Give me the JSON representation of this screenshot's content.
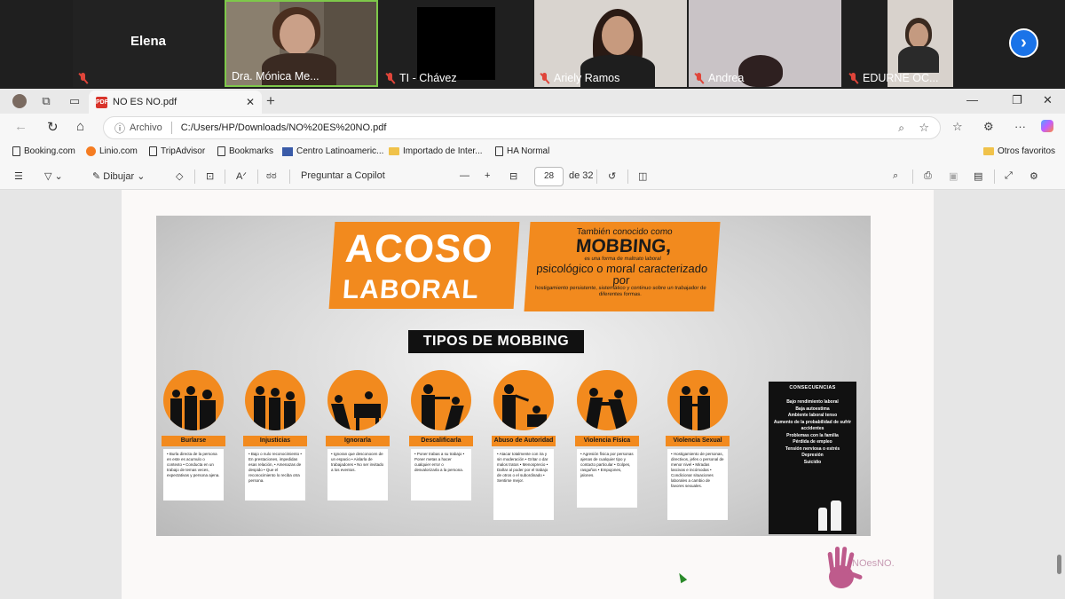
{
  "call": {
    "participants": [
      {
        "name": "Elena"
      },
      {
        "name": "Dra. Mónica Me..."
      },
      {
        "name": "TI - Chávez"
      },
      {
        "name": "Ariely Ramos"
      },
      {
        "name": "Andrea"
      },
      {
        "name": "EDURNE OC..."
      }
    ],
    "next_label": "›"
  },
  "browser": {
    "tab_title": "NO ES NO.pdf",
    "tab_badge": "PDF",
    "address_scheme": "Archivo",
    "url": "C:/Users/HP/Downloads/NO%20ES%20NO.pdf",
    "bookmarks": [
      "Booking.com",
      "Linio.com",
      "TripAdvisor",
      "Bookmarks",
      "Centro Latinoameric...",
      "Importado de Inter...",
      "HA Normal"
    ],
    "other_favorites": "Otros favoritos"
  },
  "pdf_toolbar": {
    "draw_label": "Dibujar",
    "copilot_label": "Preguntar a Copilot",
    "page_current": "28",
    "page_total": "de 32"
  },
  "infographic": {
    "title_line1": "ACOSO",
    "title_line2": "LABORAL",
    "def_intro": "También conocido como",
    "def_term": "MOBBING,",
    "def_small1": "es una forma de maltrato laboral",
    "def_mid": "psicológico o moral caracterizado por",
    "def_small2": "hostigamiento persistente, sistemático y continuo sobre un trabajador de diferentes formas.",
    "tipos_title": "TIPOS DE MOBBING",
    "types": [
      {
        "label": "Burlarse",
        "desc": "• Burla directa de la persona en este es acumulo o contexto • Conducta en un trabajo de temas veces, expectativas y persona ajena."
      },
      {
        "label": "Injusticias",
        "desc": "• Bajo o nulo reconocimiento • En prestaciones, impedidas esas relación, • Amenazas de despido • Que el reconocimiento lo reciba otra persona."
      },
      {
        "label": "Ignorarla",
        "desc": "• Ignoran que desconocen de un espacio • Aislarla de trabajadores • No ser invitado a los eventos."
      },
      {
        "label": "Descalificarla",
        "desc": "• Poner trabas a su trabajo • Poner metas a hacer cualquier error o desvalorizarla a la persona."
      },
      {
        "label": "Abuso de Autoridad",
        "desc": "• Atacar totalmente con ira y sin moderación • Gritar o dar malos tratos • Menosprecio • Dañar al poder por el trabajo de otros o el subordinado • Sentirse mejor."
      },
      {
        "label": "Violencia Física",
        "desc": "• Agresión física por personas ajenas de cualquier tipo y contacto particular • Golpes, rasguños • Empujones, jalones."
      },
      {
        "label": "Violencia Sexual",
        "desc": "• Hostigamiento de personas, directivos, jefes o personal de menor nivel • Miradas lascivas e incómodas • Condicionar situaciones laborales a cambio de favores sexuales."
      }
    ],
    "conseq_title": "CONSECUENCIAS",
    "conseq_items": [
      "Bajo rendimiento laboral",
      "Baja autoestima",
      "Ambiente laboral tenso",
      "Aumento de la probabilidad de sufrir accidentes",
      "Problemas con la familia",
      "Pérdida de empleo",
      "Tensión nerviosa o estrés",
      "Depresión",
      "Suicidio"
    ]
  },
  "watermark_text": "NOesNO.",
  "colors": {
    "accent": "#f28a1e",
    "dark": "#111111",
    "browser_bg": "#f7f7f7"
  }
}
